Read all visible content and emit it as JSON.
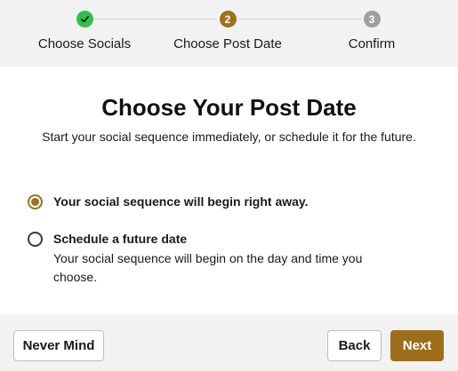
{
  "stepper": {
    "steps": [
      {
        "number": "✓",
        "label": "Choose Socials",
        "state": "complete",
        "color": "#2fbf4a"
      },
      {
        "number": "2",
        "label": "Choose Post Date",
        "state": "current",
        "color": "#a0701f"
      },
      {
        "number": "3",
        "label": "Confirm",
        "state": "upcoming",
        "color": "#9e9e9e"
      }
    ]
  },
  "main": {
    "title": "Choose Your Post Date",
    "subtitle": "Start your social sequence immediately, or schedule it for the future.",
    "options": [
      {
        "label": "Your social sequence will begin right away.",
        "selected": true
      },
      {
        "label": "Schedule a future date",
        "description": "Your social sequence will begin on the day and time you choose.",
        "selected": false
      }
    ]
  },
  "footer": {
    "never_mind_label": "Never Mind",
    "back_label": "Back",
    "next_label": "Next"
  },
  "colors": {
    "accent": "#9e6d1b",
    "complete": "#2fbf4a",
    "inactive": "#9e9e9e"
  }
}
